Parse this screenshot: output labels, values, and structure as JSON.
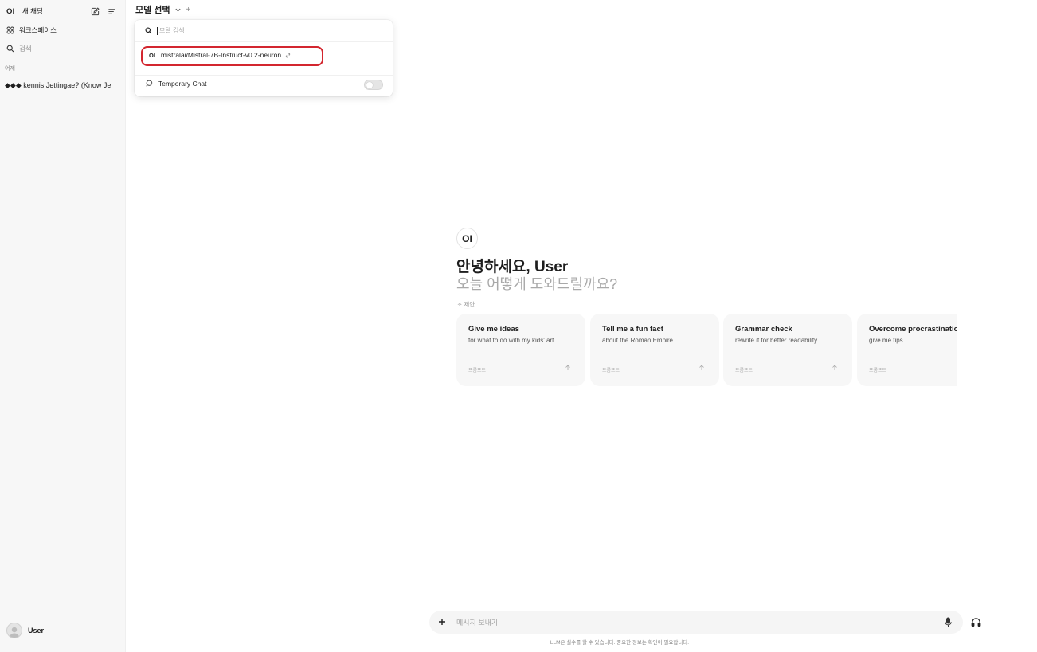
{
  "sidebar": {
    "logo": "OI",
    "new_chat": "새 채팅",
    "workspace": "워크스페이스",
    "search": "검색",
    "section_yesterday": "어제",
    "chats": [
      "◆◆◆ kennis Jettingae? (Know Je"
    ],
    "user_name": "User"
  },
  "header": {
    "model_select": "모델 선택",
    "add": "+"
  },
  "dropdown": {
    "search_placeholder": "모델 검색",
    "model_logo": "OI",
    "model_name": "mistralai/Mistral-7B-Instruct-v0.2-neuron",
    "temporary_chat": "Temporary Chat",
    "temporary_chat_enabled": false
  },
  "main": {
    "logo": "OI",
    "greeting": "안녕하세요, User",
    "subtitle": "오늘 어떻게 도와드릴까요?",
    "suggest_label": "✧ 제안",
    "cards": [
      {
        "title": "Give me ideas",
        "subtitle": "for what to do with my kids' art",
        "prompt": "프롬프트"
      },
      {
        "title": "Tell me a fun fact",
        "subtitle": "about the Roman Empire",
        "prompt": "프롬프트"
      },
      {
        "title": "Grammar check",
        "subtitle": "rewrite it for better readability",
        "prompt": "프롬프트"
      },
      {
        "title": "Overcome procrastination",
        "subtitle": "give me tips",
        "prompt": "프롬프트"
      }
    ]
  },
  "composer": {
    "placeholder": "메시지 보내기",
    "value": ""
  },
  "disclaimer": "LLM은 실수를 할 수 있습니다. 중요한 정보는 확인이 필요합니다.",
  "colors": {
    "highlight": "#d3262f",
    "sidebar_bg": "#f7f7f7",
    "card_bg": "#f7f7f7"
  }
}
